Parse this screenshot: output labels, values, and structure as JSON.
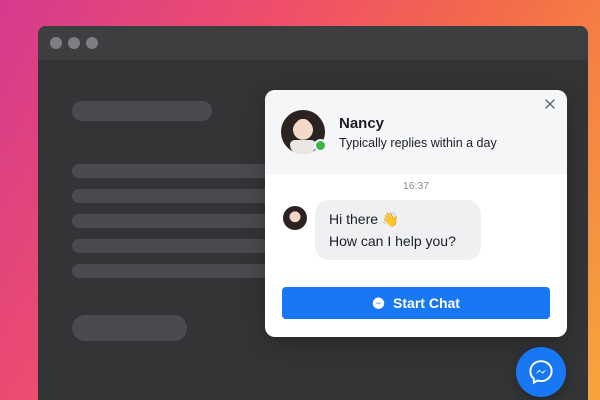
{
  "chat": {
    "agent_name": "Nancy",
    "agent_status": "Typically replies within a day",
    "close_icon": "close-icon",
    "online_indicator_color": "#3bb54a",
    "timestamp": "16:37",
    "messages": [
      {
        "line1": "Hi there 👋",
        "line2": "How can I help you?"
      }
    ],
    "start_button_label": "Start Chat",
    "start_button_icon": "messenger-icon"
  },
  "launcher": {
    "icon": "messenger-icon"
  },
  "colors": {
    "accent": "#1877f2",
    "window_bg": "#333436",
    "skeleton": "#4a4b4e"
  }
}
